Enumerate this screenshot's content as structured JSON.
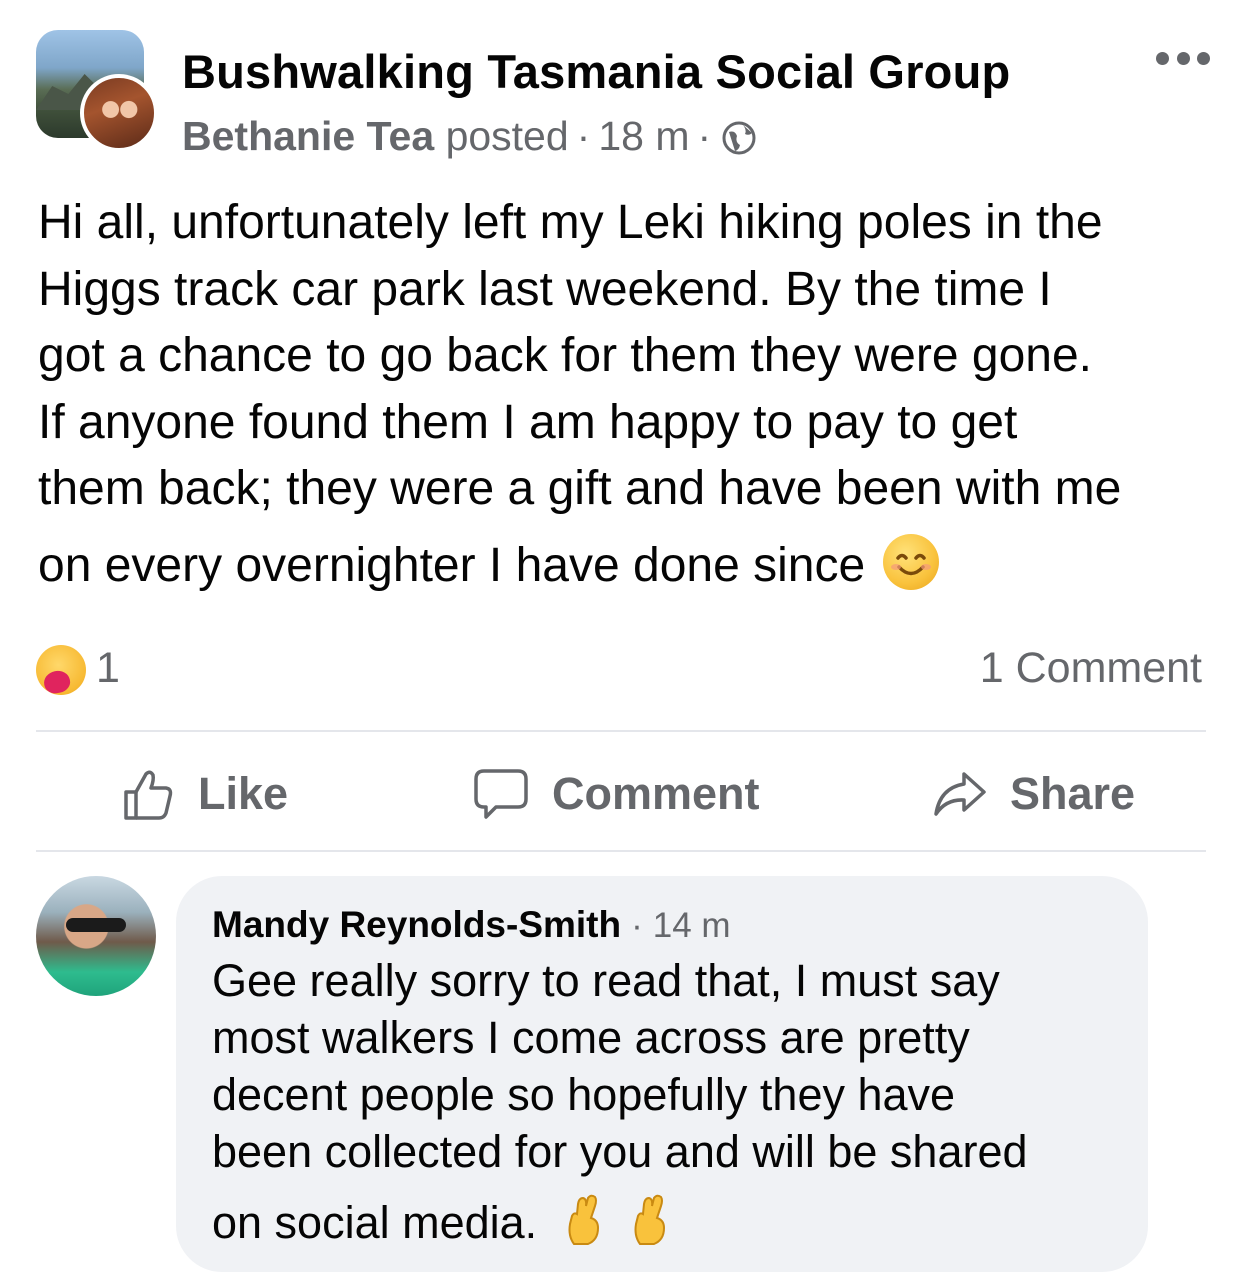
{
  "post": {
    "group_name": "Bushwalking Tasmania Social Group",
    "author": "Bethanie Tea",
    "action": "posted",
    "separator": "·",
    "time": "18 m",
    "body_lines": [
      "Hi all, unfortunately left my Leki hiking poles in the",
      "Higgs track car park last weekend. By the time I",
      "got a chance to go back for them they were gone.",
      "If anyone found them I am happy to pay to get",
      "them back; they were a gift and have been with me",
      "on every overnighter I have done since"
    ],
    "body_emoji": "smiling-face-icon",
    "reaction_icon": "care-reaction-icon",
    "reaction_count": "1",
    "comment_count_label": "1 Comment"
  },
  "actions": {
    "like_label": "Like",
    "comment_label": "Comment",
    "share_label": "Share"
  },
  "comment": {
    "author": "Mandy Reynolds-Smith",
    "separator": "·",
    "time": "14 m",
    "lines": [
      "Gee really sorry to read that, I must say",
      "most walkers I come across are pretty",
      "decent people so hopefully they have",
      "been collected for you and  will be shared",
      "on social media."
    ],
    "emoji": "crossed-fingers-icon"
  },
  "colors": {
    "text_primary": "#050505",
    "text_secondary": "#65676b",
    "bubble_bg": "#f0f2f5",
    "divider": "#e4e6eb"
  }
}
